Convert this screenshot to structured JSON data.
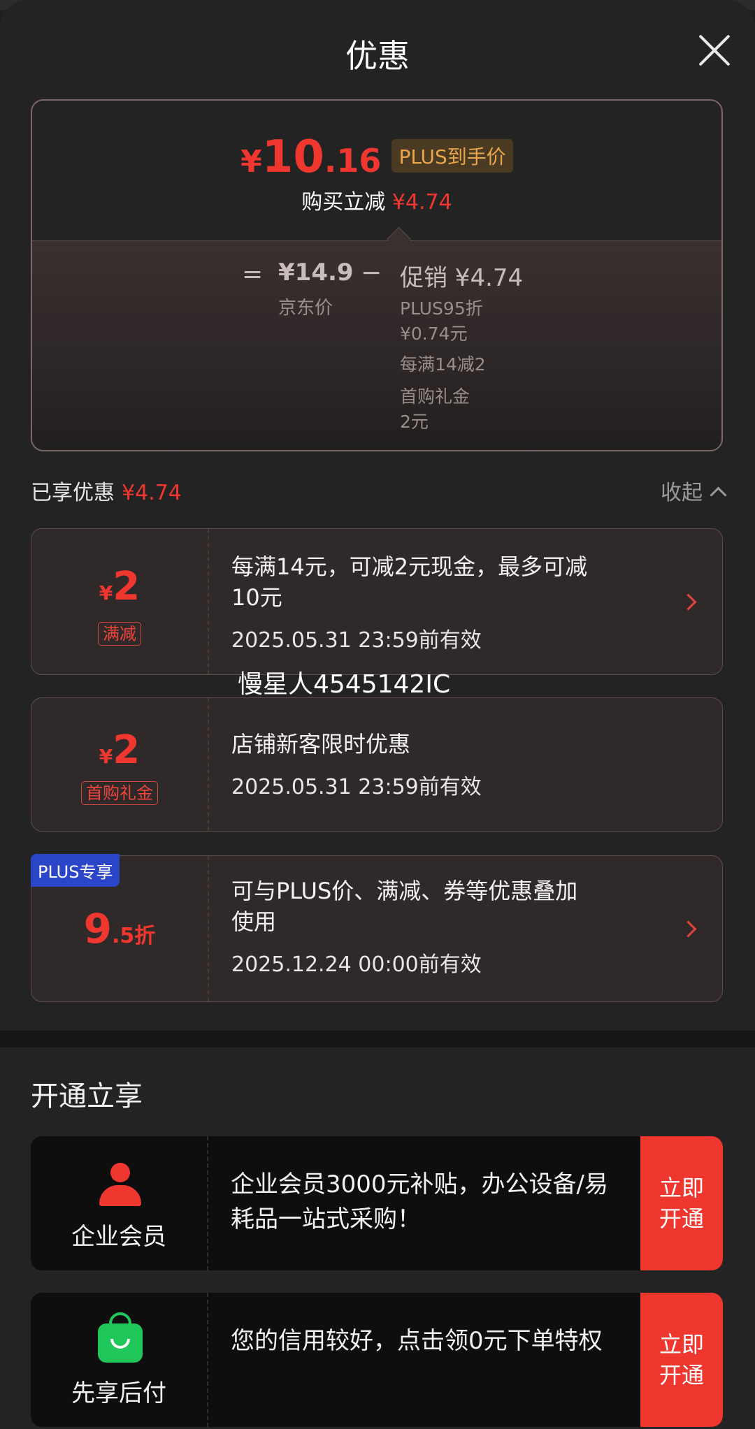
{
  "header": {
    "title": "优惠"
  },
  "summary": {
    "price_yen": "¥",
    "price_int": "10",
    "price_dec": ".16",
    "plus_tag": "PLUS到手价",
    "instant_label": "购买立减",
    "instant_value": "¥4.74",
    "equals": "=",
    "jd_price": "¥14.9",
    "jd_label": "京东价",
    "minus": "−",
    "promo_title": "促销 ¥4.74",
    "promo_lines": [
      "PLUS95折",
      "¥0.74元",
      "每满14减2",
      "首购礼金",
      "2元"
    ]
  },
  "enjoyed": {
    "label": "已享优惠",
    "value": "¥4.74",
    "collapse_label": "收起"
  },
  "coupons": [
    {
      "yen": "¥",
      "amount": "2",
      "tag": "满减",
      "text_line1": "每满14元，可减2元现金，最多可减",
      "text_line2": "10元",
      "valid": "2025.05.31 23:59前有效"
    },
    {
      "yen": "¥",
      "amount": "2",
      "tag": "首购礼金",
      "text_line1": "店铺新客限时优惠",
      "valid": "2025.05.31 23:59前有效"
    },
    {
      "badge": "PLUS专享",
      "disc_big": "9",
      "disc_small": ".5折",
      "text_line1": "可与PLUS价、满减、券等优惠叠加",
      "text_line2": "使用",
      "valid": "2025.12.24 00:00前有效"
    }
  ],
  "watermark": "慢星人4545142IC",
  "open_section": {
    "title": "开通立享"
  },
  "members": [
    {
      "label": "企业会员",
      "text": " 企业会员3000元补贴，办公设备/易耗品一站式采购！",
      "button": "立即开通",
      "icon": "person-icon",
      "icon_color": "#f0372f"
    },
    {
      "label": "先享后付",
      "text": "您的信用较好，点击领0元下单特权",
      "button": "立即开通",
      "icon": "shopping-bag-icon",
      "icon_color": "#1fc65a"
    }
  ],
  "colors": {
    "accent": "#f0372f",
    "plus_badge": "#2a45c7",
    "plus_tag_text": "#e9a54c"
  }
}
